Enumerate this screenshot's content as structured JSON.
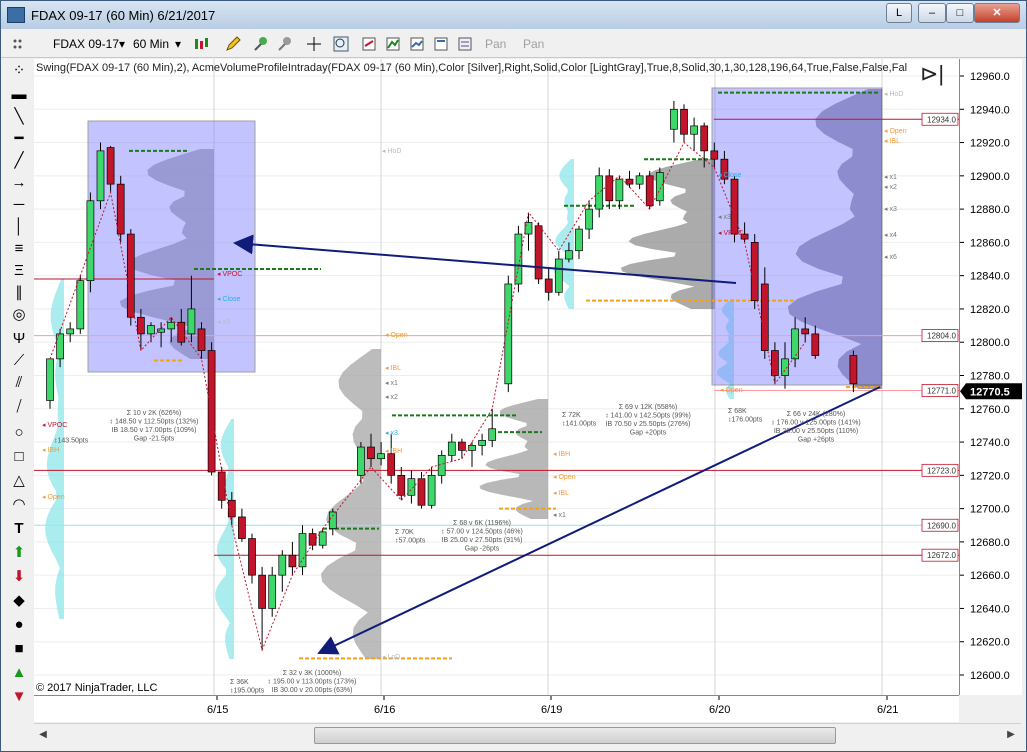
{
  "window": {
    "title": "FDAX 09-17 (60 Min)  6/21/2017",
    "btn_link": "L",
    "btn_min": "–",
    "btn_max": "□",
    "btn_close": "✕"
  },
  "toolbar": {
    "instrument": "FDAX 09-17",
    "interval": "60 Min",
    "pan1": "Pan",
    "pan2": "Pan"
  },
  "chart": {
    "indicator_label": "Swing(FDAX 09-17 (60 Min),2), AcmeVolumeProfileIntraday(FDAX 09-17 (60 Min),Color [Silver],Right,Solid,Color [LightGray],True,8,Solid,30,1,30,128,196,64,True,False,False,Fal",
    "copyright": "© 2017 NinjaTrader, LLC",
    "colors": {
      "up": "#3ed86a",
      "down": "#c2142b",
      "box": "#7c7cff",
      "arrow": "#101b7a",
      "vpoc": "#c2142b",
      "poc_green": "#1a7a1a",
      "poc_orange": "#f2a21b"
    }
  },
  "yaxis": {
    "ticks": [
      "12960.0",
      "12940.0",
      "12920.0",
      "12900.0",
      "12880.0",
      "12860.0",
      "12840.0",
      "12820.0",
      "12800.0",
      "12780.0",
      "12760.0",
      "12740.0",
      "12720.0",
      "12700.0",
      "12680.0",
      "12660.0",
      "12640.0",
      "12620.0",
      "12600.0"
    ],
    "current_price": "12770.5",
    "price_tags": [
      "12934.0",
      "12804.0",
      "12771.0",
      "12723.0",
      "12690.0",
      "12672.0"
    ]
  },
  "xaxis": {
    "labels": [
      "6/15",
      "6/16",
      "6/19",
      "6/20",
      "6/21"
    ]
  },
  "annotations": {
    "labels": [
      "HoD",
      "VPOC",
      "Close",
      "x3",
      "Open",
      "IBL",
      "x1",
      "x2",
      "IBH",
      "LoD",
      "x4",
      "x6"
    ],
    "stats": [
      {
        "line1": "Σ 10 v 2K (626%)",
        "line2": "↕ 148.50 v 112.50pts (132%)",
        "line3": "IB 18.50 v 17.00pts (109%)",
        "line4": "Gap -21.5pts"
      },
      {
        "line1": "Σ 32 v 3K (1000%)",
        "line2": "↕ 195.00 v 113.00pts (173%)",
        "line3": "IB 30.00 v 20.00pts (63%)",
        "line4": ""
      },
      {
        "line1": "Σ 68 v 6K (1196%)",
        "line2": "↕ 57.00 v 124.50pts (46%)",
        "line3": "IB 25.00 v 27.50pts (91%)",
        "line4": "Gap -26pts"
      },
      {
        "line1": "Σ 69 v 12K (558%)",
        "line2": "↕ 141.00 v 142.50pts (99%)",
        "line3": "IB 70.50 v 25.50pts (276%)",
        "line4": "Gap +20pts"
      },
      {
        "line1": "Σ 66 v 24K (280%)",
        "line2": "↕ 176.00 v 125.00pts (141%)",
        "line3": "IB 28.00 v 25.50pts (110%)",
        "line4": "Gap +26pts"
      }
    ],
    "vol": [
      {
        "a": "Σ 36K",
        "b": "↕195.00pts"
      },
      {
        "a": "Σ 70K",
        "b": "↕57.00pts"
      },
      {
        "a": "Σ 72K",
        "b": "↕141.00pts"
      },
      {
        "a": "Σ 68K",
        "b": "↕176.00pts"
      },
      {
        "a": "",
        "b": "↕143.50pts"
      }
    ]
  },
  "chart_data": {
    "type": "candlestick",
    "ylim": [
      12600,
      12965
    ],
    "candles": [
      [
        12765,
        12790,
        12760,
        12790
      ],
      [
        12790,
        12808,
        12785,
        12805
      ],
      [
        12805,
        12812,
        12800,
        12808
      ],
      [
        12808,
        12840,
        12805,
        12837
      ],
      [
        12837,
        12890,
        12830,
        12885
      ],
      [
        12885,
        12920,
        12880,
        12915
      ],
      [
        12917,
        12918,
        12890,
        12895
      ],
      [
        12895,
        12900,
        12860,
        12865
      ],
      [
        12865,
        12868,
        12810,
        12815
      ],
      [
        12815,
        12820,
        12795,
        12805
      ],
      [
        12805,
        12812,
        12800,
        12810
      ],
      [
        12806,
        12812,
        12797,
        12808
      ],
      [
        12808,
        12815,
        12800,
        12812
      ],
      [
        12812,
        12820,
        12798,
        12800
      ],
      [
        12805,
        12840,
        12800,
        12820
      ],
      [
        12808,
        12812,
        12790,
        12795
      ],
      [
        12795,
        12800,
        12720,
        12722
      ],
      [
        12722,
        12725,
        12700,
        12705
      ],
      [
        12705,
        12710,
        12690,
        12695
      ],
      [
        12695,
        12700,
        12680,
        12682
      ],
      [
        12682,
        12685,
        12655,
        12660
      ],
      [
        12660,
        12665,
        12615,
        12640
      ],
      [
        12640,
        12665,
        12635,
        12660
      ],
      [
        12660,
        12675,
        12650,
        12672
      ],
      [
        12672,
        12680,
        12660,
        12665
      ],
      [
        12665,
        12690,
        12660,
        12685
      ],
      [
        12685,
        12688,
        12675,
        12678
      ],
      [
        12678,
        12688,
        12676,
        12686
      ],
      [
        12688,
        12700,
        12684,
        12698
      ],
      [
        12720,
        12740,
        12715,
        12737
      ],
      [
        12737,
        12745,
        12725,
        12730
      ],
      [
        12730,
        12740,
        12726,
        12733
      ],
      [
        12733,
        12745,
        12715,
        12720
      ],
      [
        12720,
        12725,
        12705,
        12708
      ],
      [
        12708,
        12723,
        12703,
        12718
      ],
      [
        12718,
        12722,
        12700,
        12702
      ],
      [
        12702,
        12725,
        12700,
        12720
      ],
      [
        12720,
        12735,
        12715,
        12732
      ],
      [
        12732,
        12745,
        12728,
        12740
      ],
      [
        12740,
        12742,
        12730,
        12735
      ],
      [
        12735,
        12740,
        12725,
        12738
      ],
      [
        12738,
        12745,
        12732,
        12741
      ],
      [
        12741,
        12760,
        12737,
        12748
      ],
      [
        12775,
        12840,
        12770,
        12835
      ],
      [
        12835,
        12870,
        12830,
        12865
      ],
      [
        12865,
        12878,
        12855,
        12872
      ],
      [
        12870,
        12872,
        12835,
        12838
      ],
      [
        12838,
        12845,
        12825,
        12830
      ],
      [
        12830,
        12855,
        12828,
        12850
      ],
      [
        12850,
        12860,
        12848,
        12855
      ],
      [
        12855,
        12870,
        12850,
        12868
      ],
      [
        12868,
        12885,
        12862,
        12880
      ],
      [
        12880,
        12905,
        12875,
        12900
      ],
      [
        12900,
        12904,
        12880,
        12885
      ],
      [
        12885,
        12900,
        12880,
        12898
      ],
      [
        12898,
        12903,
        12893,
        12895
      ],
      [
        12895,
        12902,
        12892,
        12900
      ],
      [
        12900,
        12903,
        12880,
        12882
      ],
      [
        12885,
        12905,
        12882,
        12902
      ],
      [
        12928,
        12945,
        12920,
        12940
      ],
      [
        12940,
        12943,
        12920,
        12925
      ],
      [
        12925,
        12935,
        12915,
        12930
      ],
      [
        12930,
        12932,
        12905,
        12915
      ],
      [
        12915,
        12920,
        12905,
        12910
      ],
      [
        12910,
        12915,
        12895,
        12898
      ],
      [
        12898,
        12900,
        12860,
        12865
      ],
      [
        12865,
        12872,
        12860,
        12862
      ],
      [
        12860,
        12865,
        12820,
        12825
      ],
      [
        12835,
        12845,
        12790,
        12795
      ],
      [
        12795,
        12800,
        12775,
        12780
      ],
      [
        12780,
        12800,
        12772,
        12790
      ],
      [
        12790,
        12815,
        12785,
        12808
      ],
      [
        12808,
        12815,
        12800,
        12805
      ],
      [
        12805,
        12810,
        12790,
        12792
      ],
      [
        12792,
        12795,
        12770,
        12775
      ]
    ]
  }
}
